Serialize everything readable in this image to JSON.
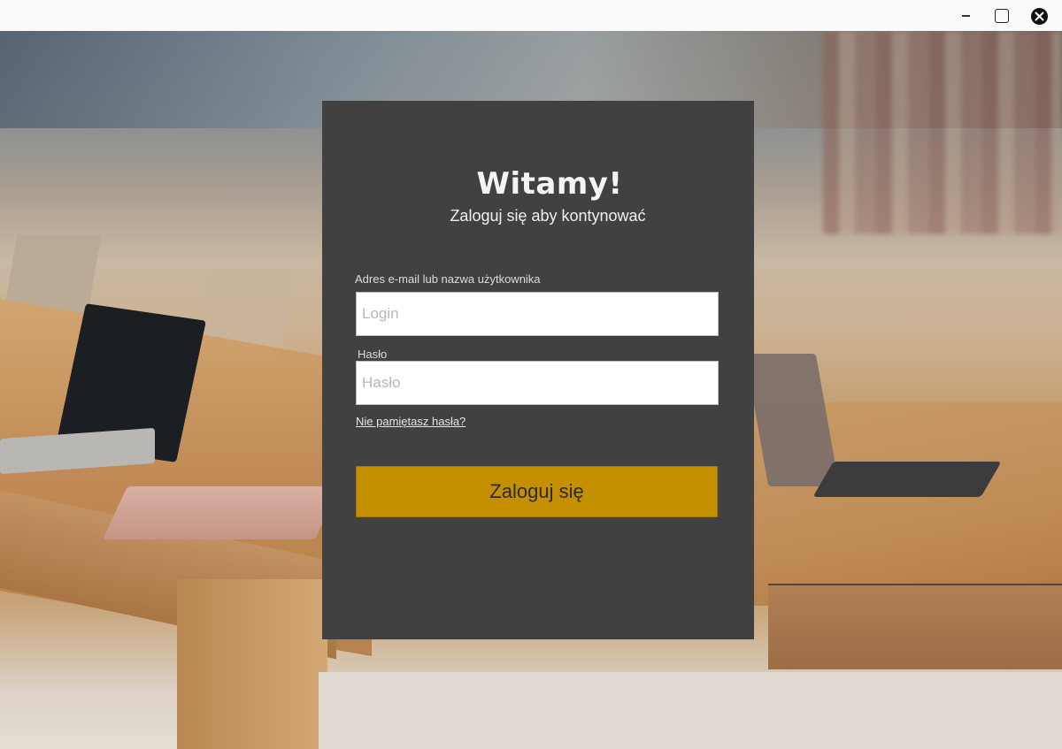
{
  "window": {
    "controls": {
      "minimize_icon": "minimize-icon",
      "maximize_icon": "maximize-icon",
      "close_icon": "close-icon"
    }
  },
  "login": {
    "title": "Witamy!",
    "subtitle": "Zaloguj się aby kontynować",
    "username_label": "Adres e-mail lub nazwa użytkownika",
    "username_placeholder": "Login",
    "username_value": "",
    "password_label": "Hasło",
    "password_placeholder": "Hasło",
    "password_value": "",
    "forgot_link": "Nie pamiętasz hasła?",
    "submit_label": "Zaloguj się"
  },
  "colors": {
    "panel_bg": "#414141",
    "button_bg": "#c59000",
    "titlebar_bg": "#fbfaf8"
  }
}
